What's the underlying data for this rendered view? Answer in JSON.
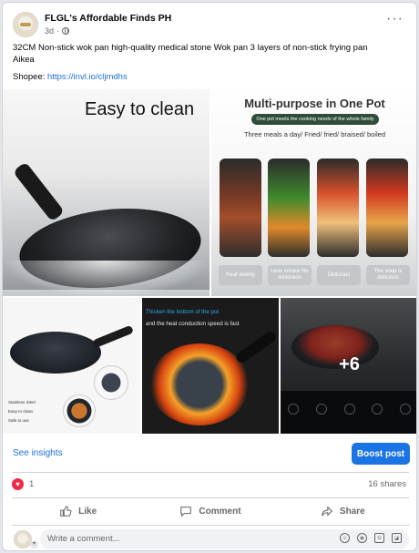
{
  "post": {
    "page_name": "FLGL's Affordable Finds PH",
    "time": "3d",
    "text_line1": "32CM Non-stick wok pan high-quality medical stone Wok pan 3 layers of non-stick frying pan",
    "text_line2": "Aikea",
    "shopee_label": "Shopee:",
    "shopee_link": "https://invl.io/cljmdhs"
  },
  "images": {
    "img1_caption": "Easy to clean",
    "img2_title": "Multi-purpose in One Pot",
    "img2_badge": "One pot meets the cooking needs of the whole family",
    "img2_subtitle": "Three meals a day/ Fried/ fried/ braised/ boiled",
    "img2_labels": [
      "Heat evenly",
      "Less smoke No stickiness",
      "Delicious",
      "The soup is delicious"
    ],
    "img3_features": [
      "Stainless Steel",
      "Easy to clean",
      "Safe to use"
    ],
    "img4_line1": "Thicken the bottom of the pot",
    "img4_line2": "and the heat conduction speed is fast",
    "more_count": "+6"
  },
  "actions": {
    "see_insights": "See insights",
    "boost_post": "Boost post",
    "reaction_count": "1",
    "shares": "16 shares",
    "like": "Like",
    "comment": "Comment",
    "share": "Share",
    "comment_placeholder": "Write a comment..."
  },
  "colors": {
    "link": "#216fdb",
    "boost": "#1b74e4",
    "heart": "#f02849"
  }
}
